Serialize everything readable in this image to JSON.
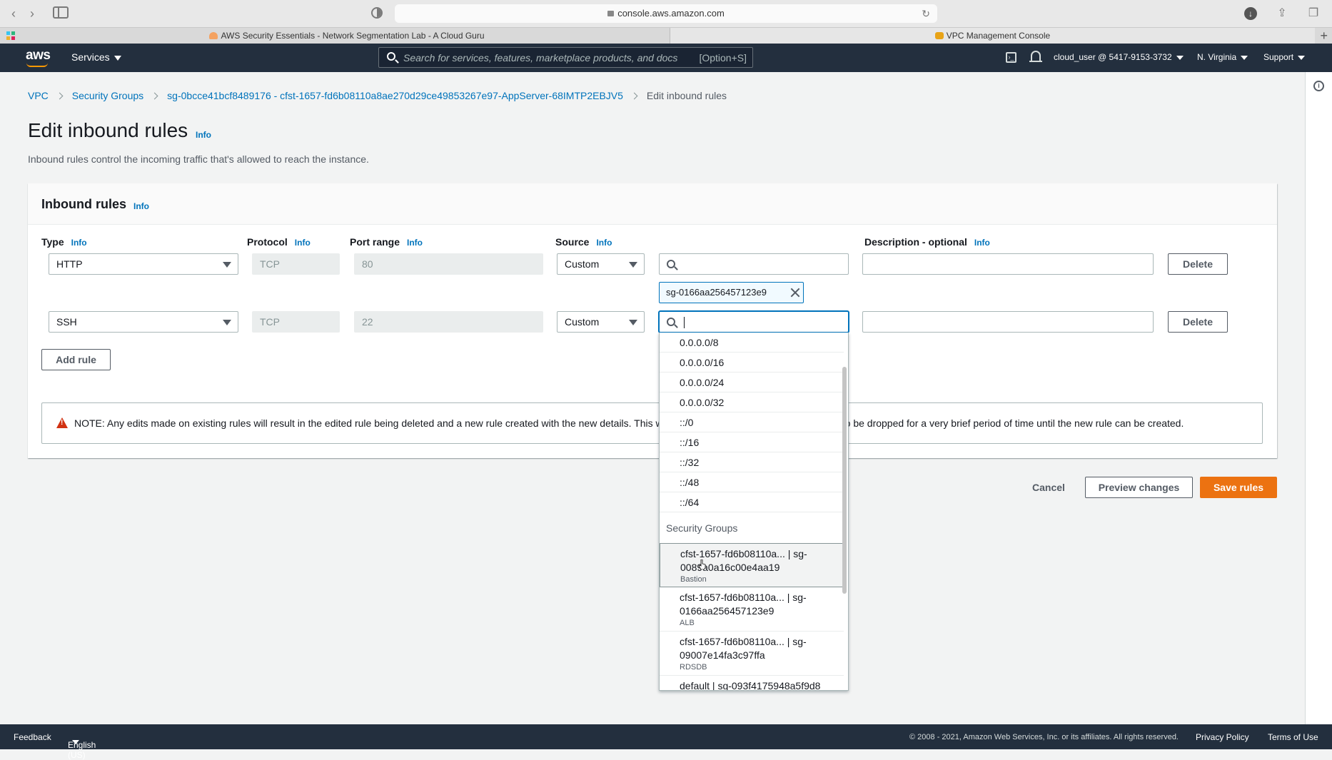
{
  "browser": {
    "url": "console.aws.amazon.com",
    "tabs": [
      {
        "title": "AWS Security Essentials - Network Segmentation Lab - A Cloud Guru"
      },
      {
        "title": "VPC Management Console"
      }
    ]
  },
  "awsnav": {
    "logo": "aws",
    "services": "Services",
    "search_placeholder": "Search for services, features, marketplace products, and docs",
    "search_shortcut": "[Option+S]",
    "user": "cloud_user @ 5417-9153-3732",
    "region": "N. Virginia",
    "support": "Support"
  },
  "breadcrumb": {
    "vpc": "VPC",
    "security_groups": "Security Groups",
    "sg": "sg-0bcce41bcf8489176 - cfst-1657-fd6b08110a8ae270d29ce49853267e97-AppServer-68IMTP2EBJV5",
    "current": "Edit inbound rules"
  },
  "page": {
    "title": "Edit inbound rules",
    "info": "Info",
    "description": "Inbound rules control the incoming traffic that's allowed to reach the instance."
  },
  "panel": {
    "title": "Inbound rules",
    "columns": {
      "type": "Type",
      "protocol": "Protocol",
      "port_range": "Port range",
      "source": "Source",
      "description": "Description - optional"
    },
    "rules": [
      {
        "type": "HTTP",
        "protocol": "TCP",
        "port": "80",
        "source": "Custom",
        "search_value": "",
        "description": "",
        "delete": "Delete",
        "token": "sg-0166aa2564571​23e9"
      },
      {
        "type": "SSH",
        "protocol": "TCP",
        "port": "22",
        "source": "Custom",
        "search_value": "",
        "description": "",
        "delete": "Delete"
      }
    ],
    "add_rule": "Add rule",
    "note": "NOTE: Any edits made on existing rules will result in the edited rule being deleted and a new rule created with the new details. This will cause traffic that depends on that rule to be dropped for a very brief period of time until the new rule can be created."
  },
  "actions": {
    "cancel": "Cancel",
    "preview": "Preview changes",
    "save": "Save rules"
  },
  "dropdown": {
    "cidrs": [
      "0.0.0.0/8",
      "0.0.0.0/16",
      "0.0.0.0/24",
      "0.0.0.0/32",
      "::/0",
      "::/16",
      "::/32",
      "::/48",
      "::/64"
    ],
    "group_label": "Security Groups",
    "security_groups": [
      {
        "line1": "cfst-1657-fd6b08110a... | sg-",
        "line2": "0089a0a16c00e4aa19",
        "name": "Bastion"
      },
      {
        "line1": "cfst-1657-fd6b08110a... | sg-",
        "line2": "0166aa2564571​23e9",
        "name": "ALB"
      },
      {
        "line1": "cfst-1657-fd6b08110a... | sg-",
        "line2": "09007e14fa3c97ffa",
        "name": "RDSDB"
      },
      {
        "line1": "default | sg-093f4175948a5f9d8",
        "line2": "",
        "name": ""
      }
    ]
  },
  "footer": {
    "feedback": "Feedback",
    "language": "English (US)",
    "copyright": "© 2008 - 2021, Amazon Web Services, Inc. or its affiliates. All rights reserved.",
    "privacy": "Privacy Policy",
    "terms": "Terms of Use"
  },
  "colors": {
    "nav_bg": "#232f3e",
    "link": "#0073bb",
    "primary": "#ec7211",
    "warning": "#d13212"
  }
}
